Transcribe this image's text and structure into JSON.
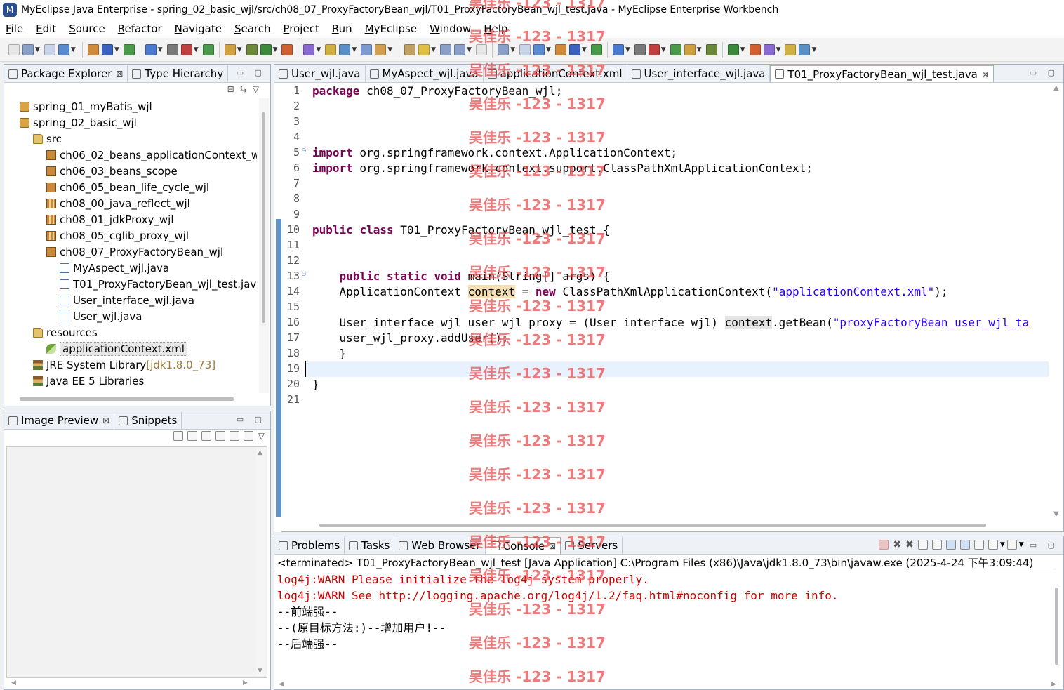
{
  "window": {
    "title": "MyEclipse Java Enterprise - spring_02_basic_wjl/src/ch08_07_ProxyFactoryBean_wjl/T01_ProxyFactoryBean_wjl_test.java - MyEclipse Enterprise Workbench"
  },
  "menu": [
    "File",
    "Edit",
    "Source",
    "Refactor",
    "Navigate",
    "Search",
    "Project",
    "Run",
    "MyEclipse",
    "Window",
    "Help"
  ],
  "left_top_tabs": [
    {
      "label": "Package Explorer",
      "close": "⊠"
    },
    {
      "label": "Type Hierarchy"
    }
  ],
  "tree": [
    {
      "label": "spring_01_myBatis_wjl",
      "icon": "proj",
      "indent": 0
    },
    {
      "label": "spring_02_basic_wjl",
      "icon": "proj",
      "indent": 0
    },
    {
      "label": "src",
      "icon": "folder",
      "indent": 1
    },
    {
      "label": "ch06_02_beans_applicationContext_w",
      "icon": "pkg",
      "indent": 2
    },
    {
      "label": "ch06_03_beans_scope",
      "icon": "pkg",
      "indent": 2
    },
    {
      "label": "ch06_05_bean_life_cycle_wjl",
      "icon": "pkg",
      "indent": 2
    },
    {
      "label": "ch08_00_java_reflect_wjl",
      "icon": "pkgo",
      "indent": 2
    },
    {
      "label": "ch08_01_jdkProxy_wjl",
      "icon": "pkgo",
      "indent": 2
    },
    {
      "label": "ch08_05_cglib_proxy_wjl",
      "icon": "pkgo",
      "indent": 2
    },
    {
      "label": "ch08_07_ProxyFactoryBean_wjl",
      "icon": "pkg",
      "indent": 2
    },
    {
      "label": "MyAspect_wjl.java",
      "icon": "jfile",
      "indent": 3
    },
    {
      "label": "T01_ProxyFactoryBean_wjl_test.java",
      "icon": "jfile",
      "indent": 3
    },
    {
      "label": "User_interface_wjl.java",
      "icon": "jfile",
      "indent": 3
    },
    {
      "label": "User_wjl.java",
      "icon": "jfile",
      "indent": 3
    },
    {
      "label": "resources",
      "icon": "folder",
      "indent": 1
    },
    {
      "label": "applicationContext.xml",
      "icon": "xmlfile",
      "indent": 2,
      "selected": true
    },
    {
      "label": "JRE System Library",
      "suffix": " [jdk1.8.0_73]",
      "icon": "lib",
      "indent": 1
    },
    {
      "label": "Java EE 5 Libraries",
      "icon": "lib",
      "indent": 1
    }
  ],
  "left_bottom_tabs": [
    {
      "label": "Image Preview",
      "close": "⊠"
    },
    {
      "label": "Snippets"
    }
  ],
  "editor_tabs": [
    {
      "label": "User_wjl.java"
    },
    {
      "label": "MyAspect_wjl.java"
    },
    {
      "label": "applicationContext.xml"
    },
    {
      "label": "User_interface_wjl.java"
    },
    {
      "label": "T01_ProxyFactoryBean_wjl_test.java",
      "active": true,
      "close": "⊠"
    }
  ],
  "code_lines": [
    [
      {
        "t": "package",
        "c": "kw"
      },
      {
        "t": " ch08_07_ProxyFactoryBean_wjl;"
      }
    ],
    [],
    [],
    [],
    [
      {
        "t": "import",
        "c": "kw"
      },
      {
        "t": " org.springframework.context.ApplicationContext;"
      }
    ],
    [
      {
        "t": "import",
        "c": "kw"
      },
      {
        "t": " org.springframework.context.support.ClassPathXmlApplicationContext;"
      }
    ],
    [],
    [],
    [],
    [
      {
        "t": "public",
        "c": "kw"
      },
      {
        "t": " "
      },
      {
        "t": "class",
        "c": "kw"
      },
      {
        "t": " T01_ProxyFactoryBean_wjl_test {"
      }
    ],
    [],
    [],
    [
      {
        "t": "    "
      },
      {
        "t": "public",
        "c": "kw"
      },
      {
        "t": " "
      },
      {
        "t": "static",
        "c": "kw"
      },
      {
        "t": " "
      },
      {
        "t": "void",
        "c": "kw"
      },
      {
        "t": " main(String[] args) {"
      }
    ],
    [
      {
        "t": "    ApplicationContext "
      },
      {
        "t": "context",
        "c": "hl1"
      },
      {
        "t": " = "
      },
      {
        "t": "new",
        "c": "kw"
      },
      {
        "t": " ClassPathXmlApplicationContext("
      },
      {
        "t": "\"applicationContext.xml\"",
        "c": "str"
      },
      {
        "t": ");"
      }
    ],
    [],
    [
      {
        "t": "    User_interface_wjl user_wjl_proxy = (User_interface_wjl) "
      },
      {
        "t": "context",
        "c": "hl2"
      },
      {
        "t": ".getBean("
      },
      {
        "t": "\"proxyFactoryBean_user_wjl_ta",
        "c": "str"
      }
    ],
    [
      {
        "t": "    user_wjl_proxy.addUser();"
      }
    ],
    [
      {
        "t": "    }"
      }
    ],
    [],
    [
      {
        "t": "}"
      }
    ],
    []
  ],
  "bottom_tabs": [
    {
      "label": "Problems"
    },
    {
      "label": "Tasks"
    },
    {
      "label": "Web Browser"
    },
    {
      "label": "Console",
      "active": true,
      "close": "⊠"
    },
    {
      "label": "Servers"
    }
  ],
  "console": {
    "header": "<terminated> T01_ProxyFactoryBean_wjl_test [Java Application] C:\\Program Files (x86)\\Java\\jdk1.8.0_73\\bin\\javaw.exe (2025-4-24 下午3:09:44)",
    "lines": [
      {
        "text": "log4j:WARN Please initialize the log4j system properly.",
        "err": true
      },
      {
        "text": "log4j:WARN See http://logging.apache.org/log4j/1.2/faq.html#noconfig for more info.",
        "err": true
      },
      {
        "text": "--前端强--"
      },
      {
        "text": "--(原目标方法:)--增加用户!--"
      },
      {
        "text": "--后端强--"
      }
    ]
  },
  "watermark": "吴佳乐 -123 - 1317",
  "colors": {
    "keyword": "#7f0055",
    "string": "#2a00ff",
    "error": "#d00000",
    "watermark": "#e84848"
  }
}
